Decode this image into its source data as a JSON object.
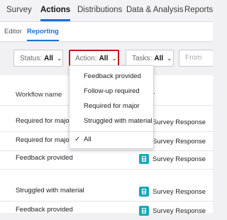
{
  "nav": {
    "tabs": [
      {
        "label": "Survey"
      },
      {
        "label": "Actions"
      },
      {
        "label": "Distributions"
      },
      {
        "label": "Data & Analysis"
      },
      {
        "label": "Reports"
      }
    ],
    "active_tab": "Actions"
  },
  "subnav": {
    "tabs": [
      {
        "label": "Editor"
      },
      {
        "label": "Reporting"
      }
    ],
    "active_tab": "Reporting"
  },
  "filters": {
    "status": {
      "label": "Status:",
      "value": "All"
    },
    "action": {
      "label": "Action:",
      "value": "All"
    },
    "tasks": {
      "label": "Tasks:",
      "value": "All"
    },
    "from": {
      "placeholder": "From"
    }
  },
  "table": {
    "headers": {
      "workflow_name": "Workflow name",
      "source_partial": "er"
    },
    "rows": [
      {
        "workflow": "Required for major",
        "source": "Survey Response"
      },
      {
        "workflow": "Required for major",
        "source": "Survey Response"
      },
      {
        "workflow": "Feedback provided",
        "source": "Survey Response"
      },
      {
        "workflow": "Struggled with material",
        "source": "Survey Response"
      },
      {
        "workflow": "Feedback provided",
        "source": "Survey Response"
      }
    ]
  },
  "action_dropdown": {
    "options": [
      {
        "label": "Feedback provided"
      },
      {
        "label": "Follow-up required"
      },
      {
        "label": "Required for major"
      },
      {
        "label": "Struggled with material"
      }
    ],
    "all_option": {
      "label": "All",
      "checked": true,
      "check_glyph": "✓"
    }
  },
  "colors": {
    "accent": "#1d6fd8",
    "highlight_border": "#c8151c",
    "source_icon": "#16a9b8"
  }
}
